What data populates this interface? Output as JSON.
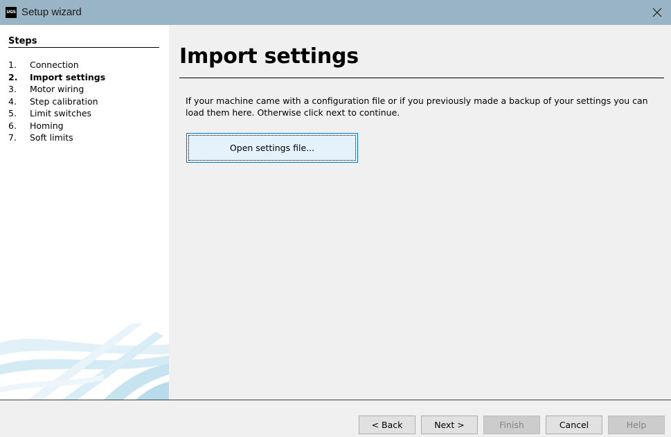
{
  "window": {
    "icon_text": "UGS",
    "title": "Setup wizard"
  },
  "sidebar": {
    "heading": "Steps",
    "steps": [
      {
        "num": "1.",
        "label": "Connection",
        "current": false
      },
      {
        "num": "2.",
        "label": "Import settings",
        "current": true
      },
      {
        "num": "3.",
        "label": "Motor wiring",
        "current": false
      },
      {
        "num": "4.",
        "label": "Step calibration",
        "current": false
      },
      {
        "num": "5.",
        "label": "Limit switches",
        "current": false
      },
      {
        "num": "6.",
        "label": "Homing",
        "current": false
      },
      {
        "num": "7.",
        "label": "Soft limits",
        "current": false
      }
    ]
  },
  "main": {
    "title": "Import settings",
    "description": "If your machine came with a configuration file or if you previously made a backup of your settings you can load them here. Otherwise click next to continue.",
    "open_button_label": "Open settings file..."
  },
  "footer": {
    "back_label": "< Back",
    "next_label": "Next >",
    "finish_label": "Finish",
    "cancel_label": "Cancel",
    "help_label": "Help"
  },
  "colors": {
    "titlebar": "#99b4c4",
    "sidebar_background": "#ffffff",
    "content_background": "#f0f0f0",
    "focused_button_fill": "#e5f1fb",
    "focused_button_border": "#0078d7",
    "sidebar_art": "#b9dcec"
  }
}
